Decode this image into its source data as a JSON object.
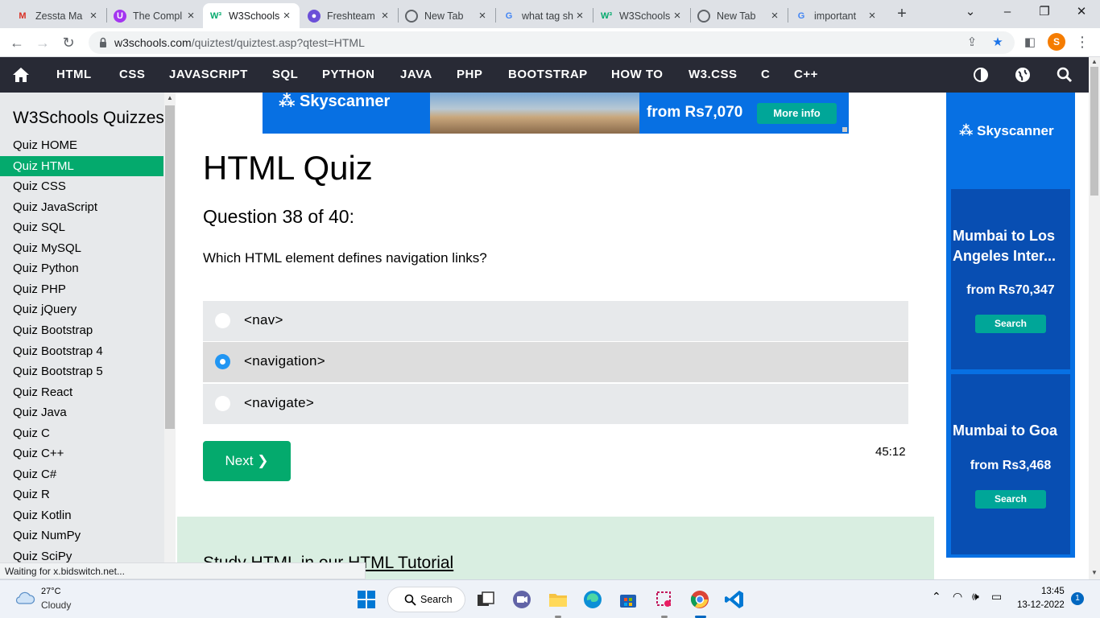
{
  "browser": {
    "tabs": [
      {
        "title": "Zessta Ma",
        "favicon": "gmail-icon"
      },
      {
        "title": "The Compl",
        "favicon": "circle-u-icon"
      },
      {
        "title": "W3Schools",
        "favicon": "w3schools-icon",
        "active": true
      },
      {
        "title": "Freshteam",
        "favicon": "freshteam-icon"
      },
      {
        "title": "New Tab",
        "favicon": "chrome-icon"
      },
      {
        "title": "what tag sh",
        "favicon": "google-icon"
      },
      {
        "title": "W3Schools",
        "favicon": "w3schools-icon"
      },
      {
        "title": "New Tab",
        "favicon": "chrome-icon"
      },
      {
        "title": "important",
        "favicon": "google-icon"
      }
    ],
    "new_tab_label": "+",
    "url_host": "w3schools.com",
    "url_path": "/quiztest/quiztest.asp?qtest=HTML",
    "profile_initial": "S",
    "status_text": "Waiting for x.bidswitch.net..."
  },
  "w3nav": {
    "links": [
      "HTML",
      "CSS",
      "JAVASCRIPT",
      "SQL",
      "PYTHON",
      "JAVA",
      "PHP",
      "BOOTSTRAP",
      "HOW TO",
      "W3.CSS",
      "C",
      "C++"
    ]
  },
  "sidebar": {
    "title": "W3Schools Quizzes",
    "items": [
      {
        "label": "Quiz HOME"
      },
      {
        "label": "Quiz HTML",
        "active": true
      },
      {
        "label": "Quiz CSS"
      },
      {
        "label": "Quiz JavaScript"
      },
      {
        "label": "Quiz SQL"
      },
      {
        "label": "Quiz MySQL"
      },
      {
        "label": "Quiz Python"
      },
      {
        "label": "Quiz PHP"
      },
      {
        "label": "Quiz jQuery"
      },
      {
        "label": "Quiz Bootstrap"
      },
      {
        "label": "Quiz Bootstrap 4"
      },
      {
        "label": "Quiz Bootstrap 5"
      },
      {
        "label": "Quiz React"
      },
      {
        "label": "Quiz Java"
      },
      {
        "label": "Quiz C"
      },
      {
        "label": "Quiz C++"
      },
      {
        "label": "Quiz C#"
      },
      {
        "label": "Quiz R"
      },
      {
        "label": "Quiz Kotlin"
      },
      {
        "label": "Quiz NumPy"
      },
      {
        "label": "Quiz SciPy"
      }
    ]
  },
  "top_ad": {
    "brand": "Skyscanner",
    "price": "from Rs7,070",
    "button": "More info"
  },
  "quiz": {
    "title": "HTML Quiz",
    "question_no": "Question 38 of 40:",
    "question": "Which HTML element defines navigation links?",
    "options": [
      {
        "label": "<nav>",
        "selected": false
      },
      {
        "label": "<navigation>",
        "selected": true
      },
      {
        "label": "<navigate>",
        "selected": false
      }
    ],
    "next_label": "Next ❯",
    "timer": "45:12",
    "study_text": "Study HTML in our HTML Tutorial"
  },
  "right_ad": {
    "brand": "Skyscanner",
    "cards": [
      {
        "dest": "Mumbai to Los Angeles Inter...",
        "price": "from Rs70,347",
        "button": "Search"
      },
      {
        "dest": "Mumbai to Goa",
        "price": "from Rs3,468",
        "button": "Search"
      }
    ]
  },
  "taskbar": {
    "temp": "27°C",
    "weather": "Cloudy",
    "search_label": "Search",
    "time": "13:45",
    "date": "13-12-2022",
    "notifications": "1"
  },
  "colors": {
    "w3_green": "#04aa6d",
    "w3_dark": "#282a35",
    "skyscanner_blue": "#0770e3",
    "radio_blue": "#2196f3"
  }
}
